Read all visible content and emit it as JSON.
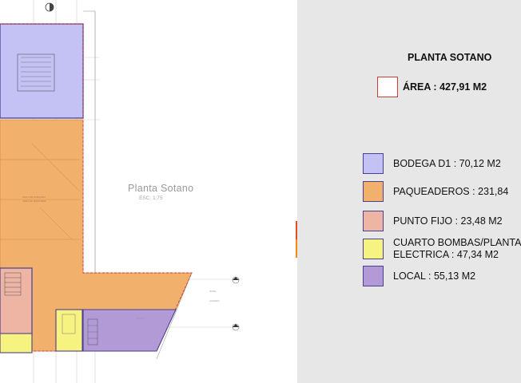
{
  "plan": {
    "label": "Planta Sotano",
    "scale": "ESC: 1:75"
  },
  "legend": {
    "title": "PLANTA SOTANO",
    "area_label": "ÁREA : 427,91 M2",
    "area_color": "#d23a3a",
    "items": [
      {
        "label": "BODEGA D1 : 70,12 M2",
        "color": "#c4c1f4"
      },
      {
        "label": "PAQUEADEROS : 231,84",
        "color": "#f2b06d"
      },
      {
        "label": "PUNTO FIJO : 23,48 M2",
        "color": "#eeb4a4"
      },
      {
        "label": "CUARTO BOMBAS/PLANTA ELECTRICA : 47,34 M2",
        "color": "#f6f381"
      },
      {
        "label": "LOCAL : 55,13 M2",
        "color": "#b29ad6"
      }
    ]
  },
  "accents": {
    "red": "#e64a22",
    "orange": "#f7870f"
  }
}
